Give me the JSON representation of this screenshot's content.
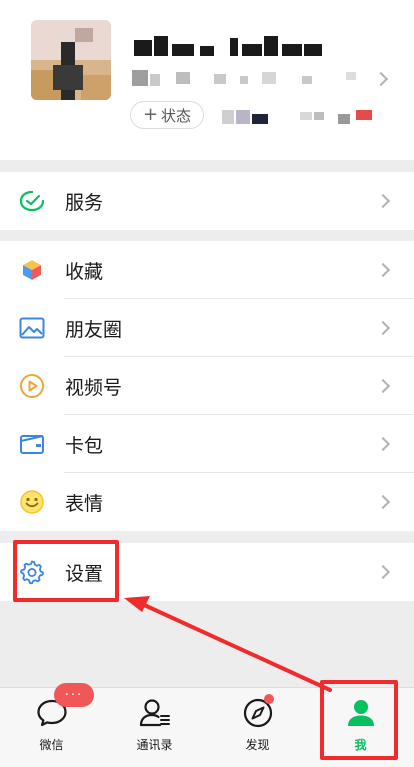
{
  "profile": {
    "status_label": "状态"
  },
  "menu": {
    "services": "服务",
    "favorites": "收藏",
    "moments": "朋友圈",
    "channels": "视频号",
    "cards": "卡包",
    "stickers": "表情",
    "settings": "设置"
  },
  "tabs": {
    "chats": "微信",
    "contacts": "通讯录",
    "discover": "发现",
    "me": "我",
    "chats_badge": "···"
  },
  "colors": {
    "accent": "#07c160",
    "highlight": "#f02b2b",
    "badge": "#f25757"
  }
}
